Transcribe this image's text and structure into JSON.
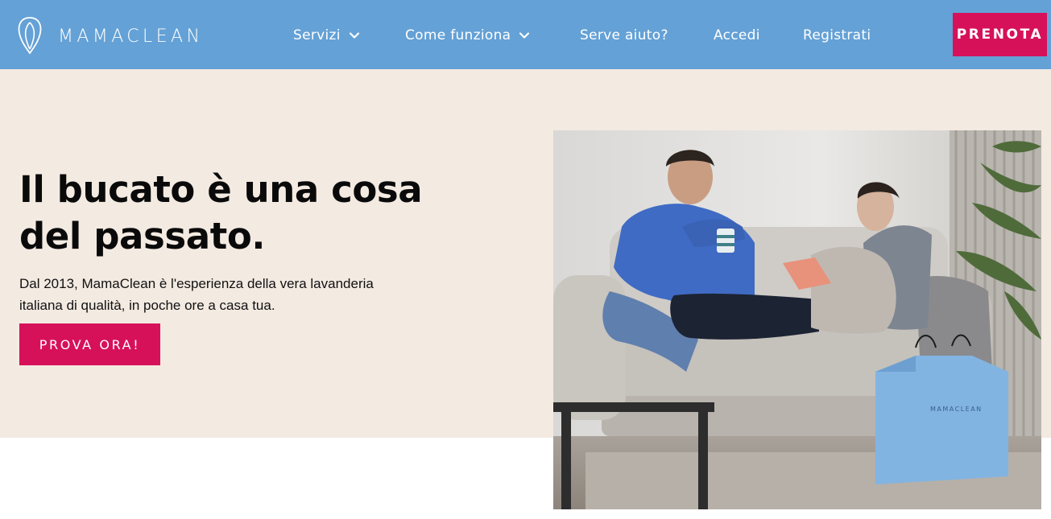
{
  "brand": {
    "name": "MAMACLEAN",
    "logo_icon": "drop-outline-logo"
  },
  "colors": {
    "header": "#64a1d6",
    "accent": "#d6115a",
    "hero_background": "#f3eae2",
    "text": "#0a0a0a"
  },
  "nav": {
    "items": [
      {
        "label": "Servizi",
        "has_dropdown": true
      },
      {
        "label": "Come funziona",
        "has_dropdown": true
      },
      {
        "label": "Serve aiuto?",
        "has_dropdown": false
      },
      {
        "label": "Accedi",
        "has_dropdown": false
      },
      {
        "label": "Registrati",
        "has_dropdown": false
      }
    ],
    "cta_label": "PRENOTA"
  },
  "hero": {
    "title": "Il bucato è una cosa del passato.",
    "subtitle": "Dal 2013, MamaClean è l'esperienza della vera lavanderia italiana di qualità, in poche ore a casa tua.",
    "cta_label": "PROVA ORA!",
    "photo": {
      "icon": "couple-on-sofa-photo",
      "bag_label": "MAMACLEAN"
    }
  }
}
